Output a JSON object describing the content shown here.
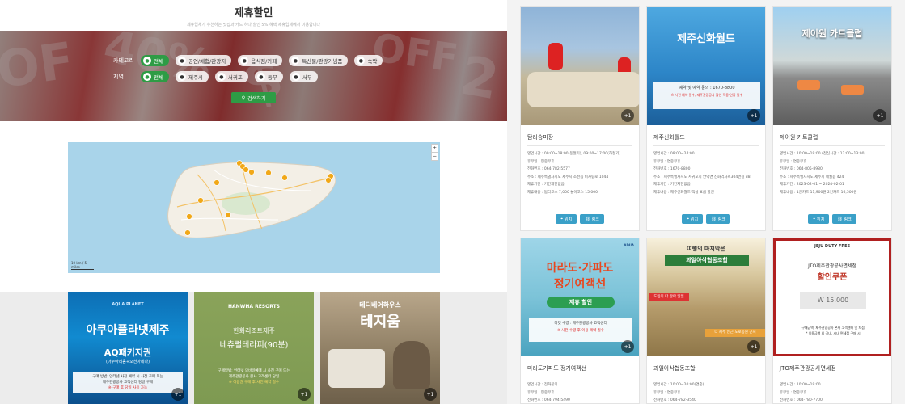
{
  "header": {
    "title": "제휴할인",
    "subtitle": "제휴업체가 추천하는 맛집과 카드 하나 할인 5% 혜택 제휴업체에서 이용합니다"
  },
  "filters": {
    "category_label": "카테고리",
    "categories": [
      "전체",
      "공연/체험/관광지",
      "음식점/카페",
      "특산물/관광기념품",
      "숙박"
    ],
    "region_label": "지역",
    "regions": [
      "전체",
      "제주시",
      "서귀포",
      "동부",
      "서부"
    ],
    "search_label": "검색하기"
  },
  "map": {
    "zoom_in": "+",
    "zoom_out": "−",
    "scale": "10 km / 5 miles"
  },
  "left_cards": [
    {
      "line1": "아쿠아플라넷제주",
      "line2": "AQ패키지권",
      "line3": "(아쿠아리움+오션아레나)",
      "note1": "구매 방법: 인터넷 사전 예약 시 사전 구매 또는",
      "note2": "제주관광공사 고객센터 당일 구매",
      "note3": "※ 구매 후 당일 사용 가능",
      "badge": "+1",
      "logo": "AQUA PLANET"
    },
    {
      "logo": "HANWHA RESORTS",
      "line1": "한화리조트제주",
      "line2": "네츄럴테라피(90분)",
      "note1": "구매방법: 인터넷 모바일예매 시 사전 구매 또는",
      "note2": "제주관광공사 본사 고객센터 당일",
      "note3": "※ 이용권 구매 후 사전 예약 필수",
      "badge": "+1"
    },
    {
      "line1": "테디베어하우스",
      "line2": "테지움",
      "badge": "+1"
    }
  ],
  "cards": [
    {
      "name": "탐라승마장",
      "badge": "+1",
      "info": [
        "영업시간 : 09:00~18:00(동절기), 09:00~17:00(하절기)",
        "휴무일 : 연중무휴",
        "전화번호 : 064-782-5577",
        "주소 : 제주특별자치도 제주시 조천읍 비자림로 1044",
        "제휴기간 : 기간제한없음",
        "제휴내용 : 탐라코스 7,000 놀이코스 15,000"
      ],
      "btn_location": "위치",
      "btn_link": "링크",
      "img_text1": "",
      "img_text2": ""
    },
    {
      "name": "제주신화월드",
      "badge": "+1",
      "info": [
        "영업시간 : 09:00~24:00",
        "휴무일 : 연중무휴",
        "전화번호 : 1670-8800",
        "주소 : 제주특별자치도 서귀포시 안덕면 신화역사로304번길 38",
        "제휴기간 : 기간제한없음",
        "제휴내용 : 제주신화월드 객실 요금 할인"
      ],
      "btn_location": "위치",
      "btn_link": "링크",
      "img_text1": "제주신화월드",
      "img_text2": "예약 및 예약 문의 : 1670-8800",
      "img_text3": "※ 사전 예약 필수, 제주관광공사 할인 적용 인증 필수"
    },
    {
      "name": "제이원 카트클럽",
      "badge": "+1",
      "info": [
        "영업시간 : 10:00~19:00 (점심시간 : 12:00~13:00)",
        "휴무일 : 연중무휴",
        "전화번호 : 064-805-8980",
        "주소 : 제주특별자치도 제주시 애월읍 424",
        "제휴기간 : 2023-02-01 ~ 2024-02-01",
        "제휴내용 : 1인카트 11,900원 2인카트 16,500원"
      ],
      "btn_location": "위치",
      "btn_link": "링크",
      "img_text1": "제이원 카트클럽"
    },
    {
      "name": "마라도가파도 정기여객선",
      "badge": "+1",
      "info": [
        "영업시간 : 전화문의",
        "휴무일 : 연중무휴",
        "전화번호 : 064-794-5490"
      ],
      "img_text1": "마라도·가파도",
      "img_text2": "정기여객선",
      "img_text3": "제휴 할인",
      "img_text4": "티켓 수령 : 제주관광공사 고객센터",
      "img_text5": "※ 사전 수령 후 이용 예약 필수",
      "logo": "ADUA"
    },
    {
      "name": "과일아삭협동조합",
      "badge": "+1",
      "info": [
        "영업시간 : 10:00~20:00(연중)",
        "휴무일 : 연중무휴",
        "전화번호 : 064-782-3540"
      ],
      "img_text1": "여행의 마지막은",
      "img_text2": "과일아삭협동조합",
      "img_text3": "도민이 다 알아 일일",
      "img_text4": "더 제주 인근 도로공원 근처"
    },
    {
      "name": "JTO제주관광공사면세점",
      "badge": "",
      "info": [
        "영업시간 : 10:00~19:00",
        "휴무일 : 연중무휴",
        "전화번호 : 064-780-7700"
      ],
      "img_text1": "JEJU DUTY FREE",
      "img_text2": "JTO제주관광공사면세점",
      "img_text3": "할인쿠폰",
      "img_text4": "W 15,000",
      "img_text5": "구매금액: 제주관광공사 본사 고객센터 및 지점",
      "img_text6": "* 이용금액 외 국내, 시내 면세점 구매 시"
    }
  ],
  "colors": {
    "accent_green": "#2e9c45",
    "button_blue": "#3aa0c8",
    "jto_red": "#b02020"
  }
}
